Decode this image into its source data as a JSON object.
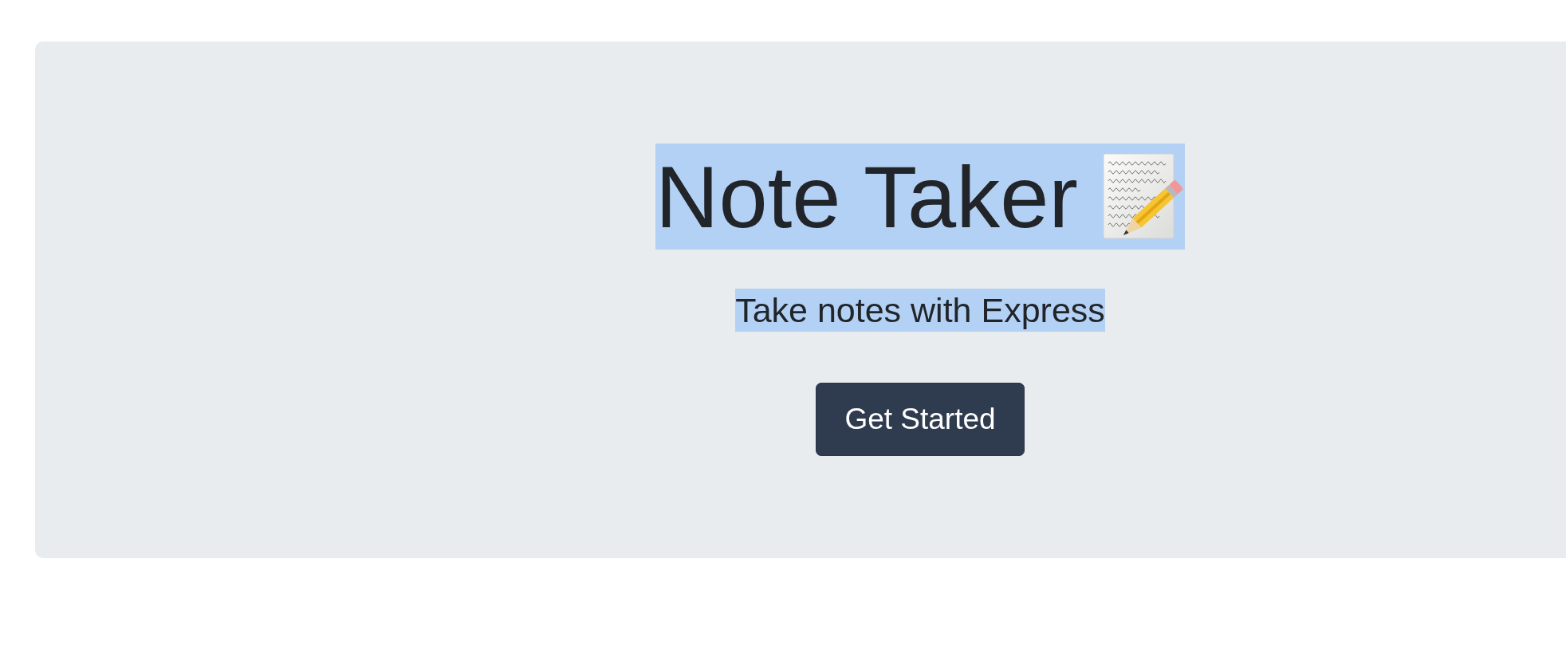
{
  "hero": {
    "title": {
      "text": "Note Taker",
      "selected": true
    },
    "tagline": {
      "text": "Take notes with Express",
      "selected": true
    },
    "button": {
      "label": "Get Started"
    }
  }
}
